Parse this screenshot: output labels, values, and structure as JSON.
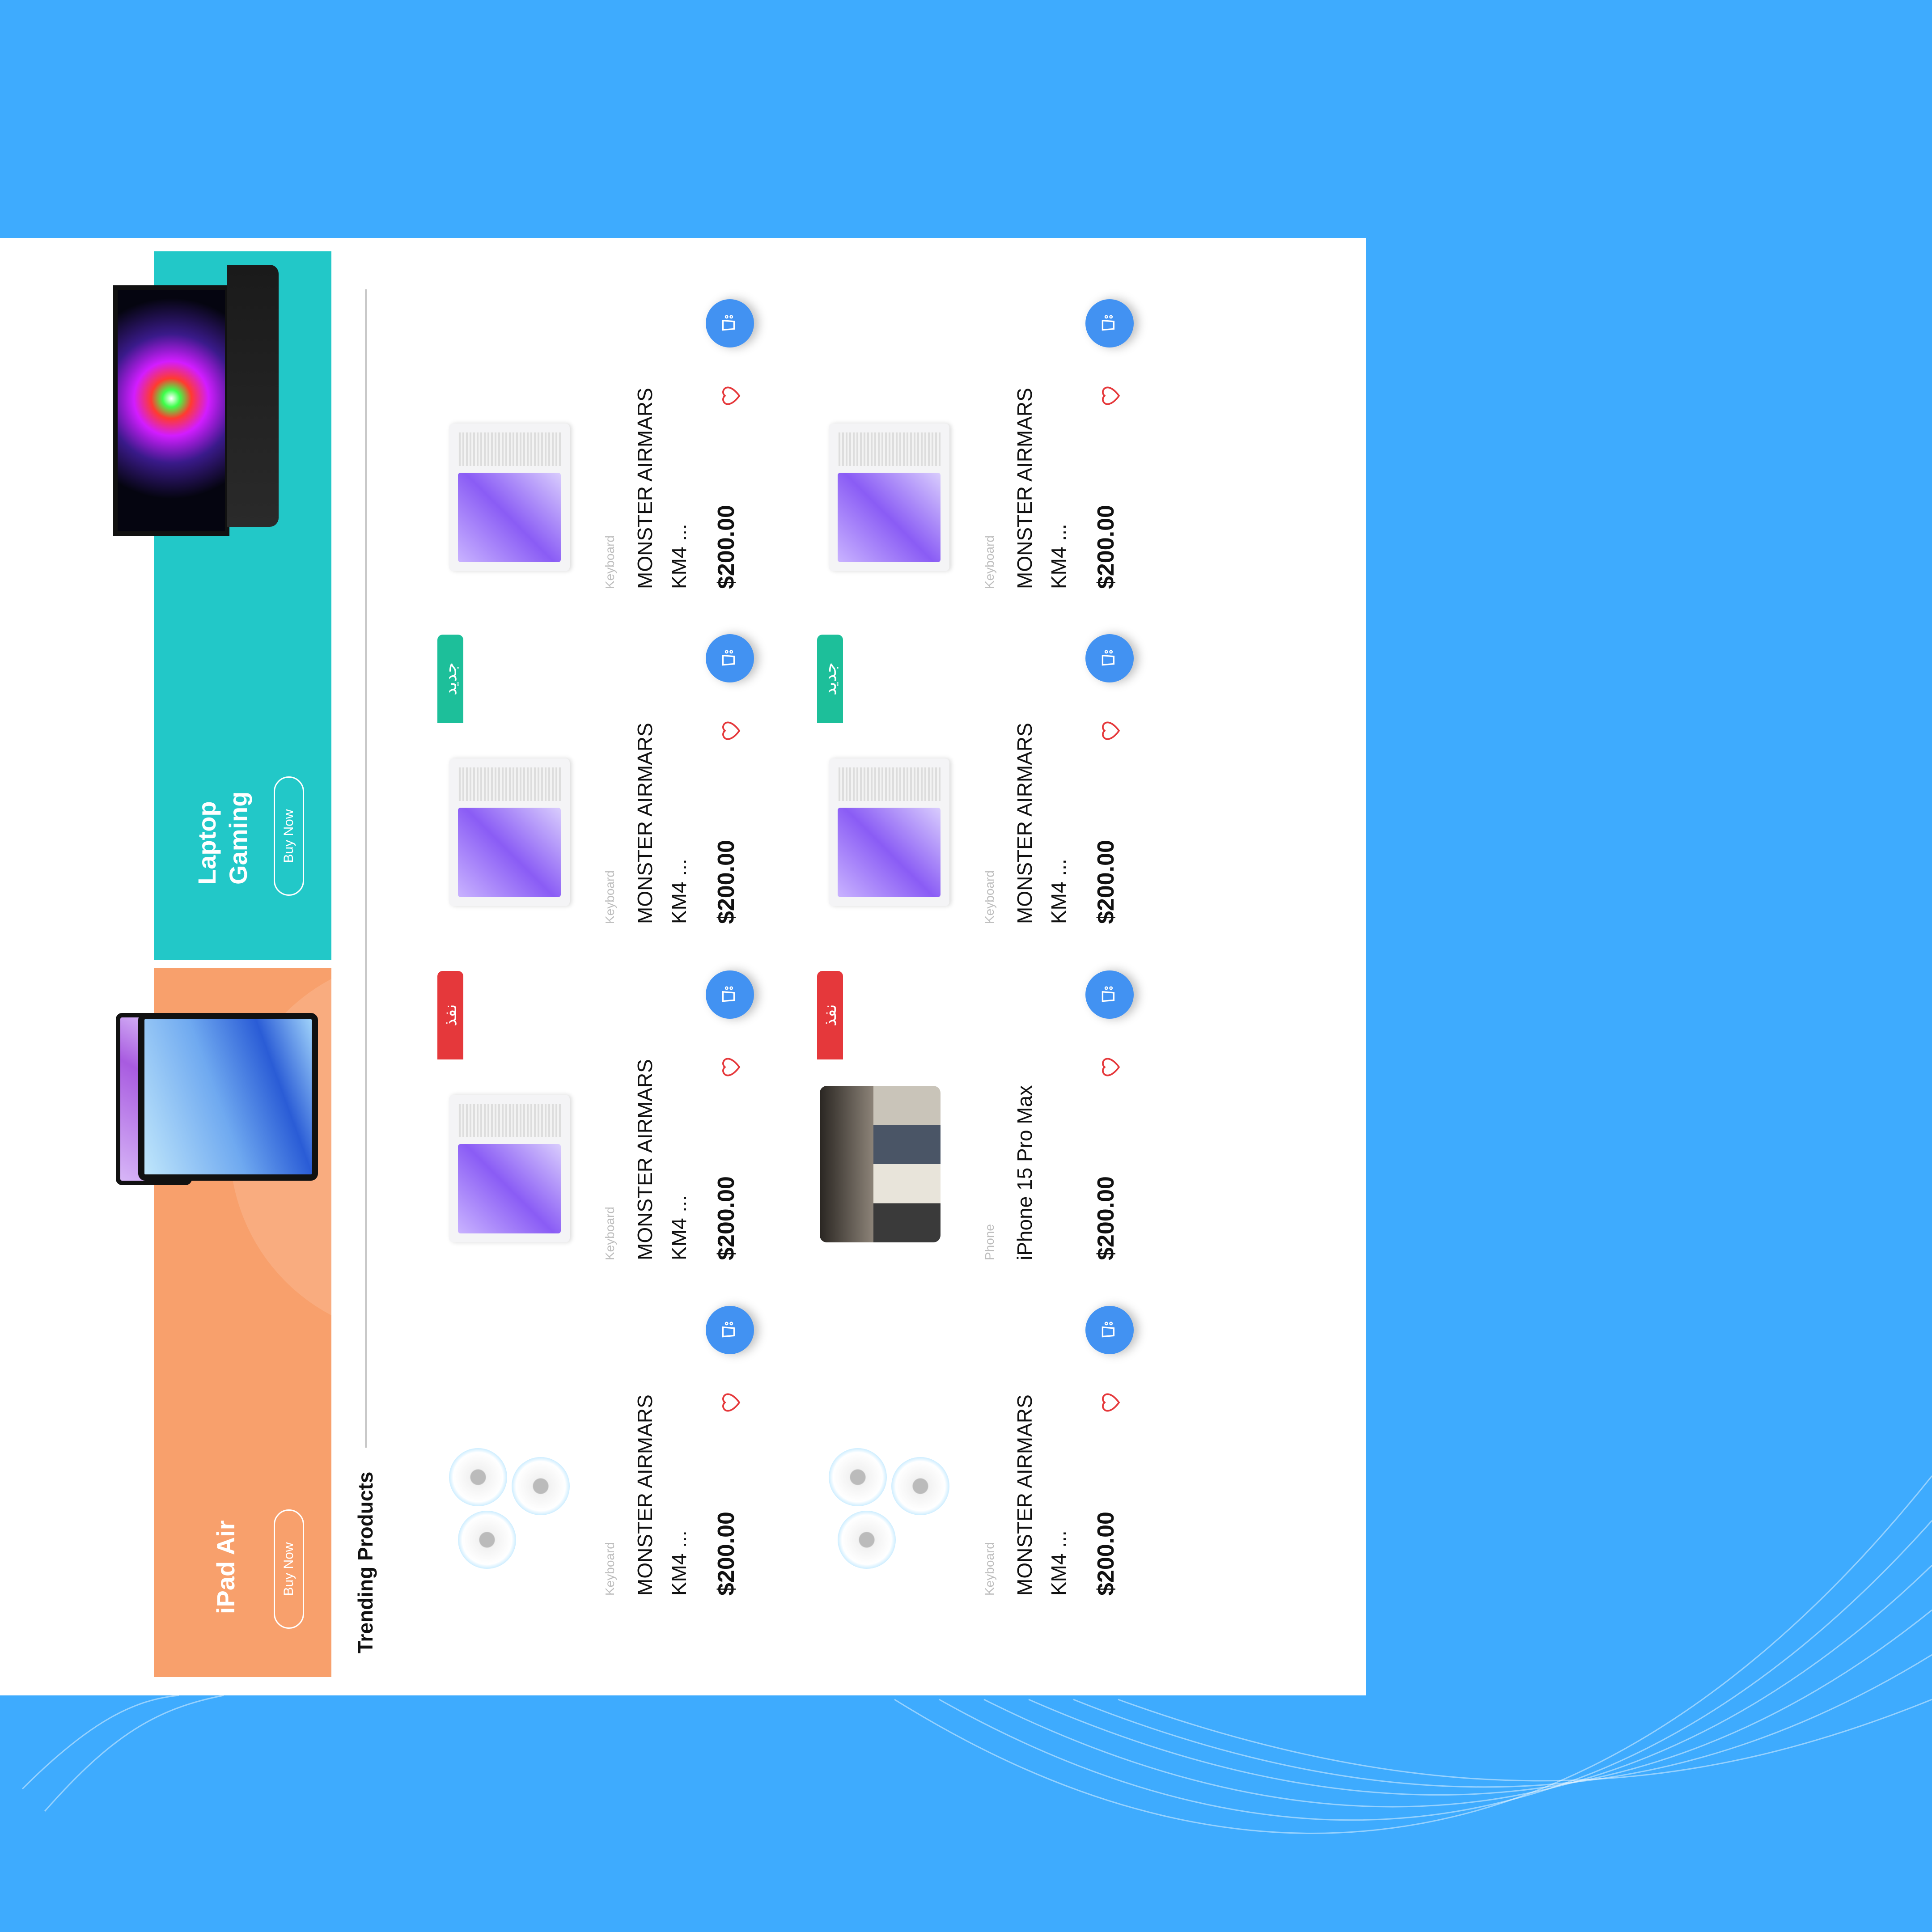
{
  "colors": {
    "background": "#3eabfe",
    "banner_ipad": "#f8a06c",
    "banner_laptop": "#22c8c8",
    "badge_new": "#1dbf9a",
    "badge_out": "#e5383b",
    "cart": "#4292f2",
    "heart": "#e5383b"
  },
  "banners": [
    {
      "title": "iPad Air",
      "button": "Buy Now",
      "image": "ipad-image"
    },
    {
      "title": "Laptop Gaming",
      "button": "Buy Now",
      "image": "laptop-image"
    }
  ],
  "section": {
    "title": "Trending Products"
  },
  "products": [
    {
      "row": 0,
      "col": 0,
      "image": "fans",
      "category": "Keyboard",
      "name": "MONSTER AIRMARS KM4 ...",
      "price": "$200.00",
      "badge": null
    },
    {
      "row": 0,
      "col": 1,
      "image": "pc",
      "category": "Keyboard",
      "name": "MONSTER AIRMARS KM4 ...",
      "price": "$200.00",
      "badge": "نفذ",
      "badge_type": "out"
    },
    {
      "row": 0,
      "col": 2,
      "image": "pc",
      "category": "Keyboard",
      "name": "MONSTER AIRMARS KM4 ...",
      "price": "$200.00",
      "badge": "جديد",
      "badge_type": "new"
    },
    {
      "row": 0,
      "col": 3,
      "image": "pc",
      "category": "Keyboard",
      "name": "MONSTER AIRMARS KM4 ...",
      "price": "$200.00",
      "badge": null
    },
    {
      "row": 1,
      "col": 0,
      "image": "fans",
      "category": "Keyboard",
      "name": "MONSTER AIRMARS KM4 ...",
      "price": "$200.00",
      "badge": null
    },
    {
      "row": 1,
      "col": 1,
      "image": "iphone",
      "category": "Phone",
      "name": "iPhone 15 Pro Max",
      "price": "$200.00",
      "badge": "نفذ",
      "badge_type": "out"
    },
    {
      "row": 1,
      "col": 2,
      "image": "pc",
      "category": "Keyboard",
      "name": "MONSTER AIRMARS KM4 ...",
      "price": "$200.00",
      "badge": "جديد",
      "badge_type": "new"
    },
    {
      "row": 1,
      "col": 3,
      "image": "pc",
      "category": "Keyboard",
      "name": "MONSTER AIRMARS KM4 ...",
      "price": "$200.00",
      "badge": null
    }
  ]
}
